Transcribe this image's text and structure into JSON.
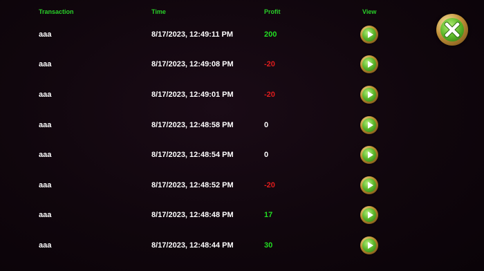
{
  "header": {
    "transaction": "Transaction",
    "time": "Time",
    "profit": "Profit",
    "view": "View"
  },
  "rows": [
    {
      "transaction": "aaa",
      "time": "8/17/2023, 12:49:11 PM",
      "profit": "200"
    },
    {
      "transaction": "aaa",
      "time": "8/17/2023, 12:49:08 PM",
      "profit": "-20"
    },
    {
      "transaction": "aaa",
      "time": "8/17/2023, 12:49:01 PM",
      "profit": "-20"
    },
    {
      "transaction": "aaa",
      "time": "8/17/2023, 12:48:58 PM",
      "profit": "0"
    },
    {
      "transaction": "aaa",
      "time": "8/17/2023, 12:48:54 PM",
      "profit": "0"
    },
    {
      "transaction": "aaa",
      "time": "8/17/2023, 12:48:52 PM",
      "profit": "-20"
    },
    {
      "transaction": "aaa",
      "time": "8/17/2023, 12:48:48 PM",
      "profit": "17"
    },
    {
      "transaction": "aaa",
      "time": "8/17/2023, 12:48:44 PM",
      "profit": "30"
    }
  ],
  "icons": {
    "view": "play-icon",
    "close": "close-x-icon"
  },
  "colors": {
    "header": "#29d129",
    "positive": "#22dd22",
    "negative": "#e01c1c",
    "neutral": "#ffffff",
    "background": "#0d050b"
  }
}
